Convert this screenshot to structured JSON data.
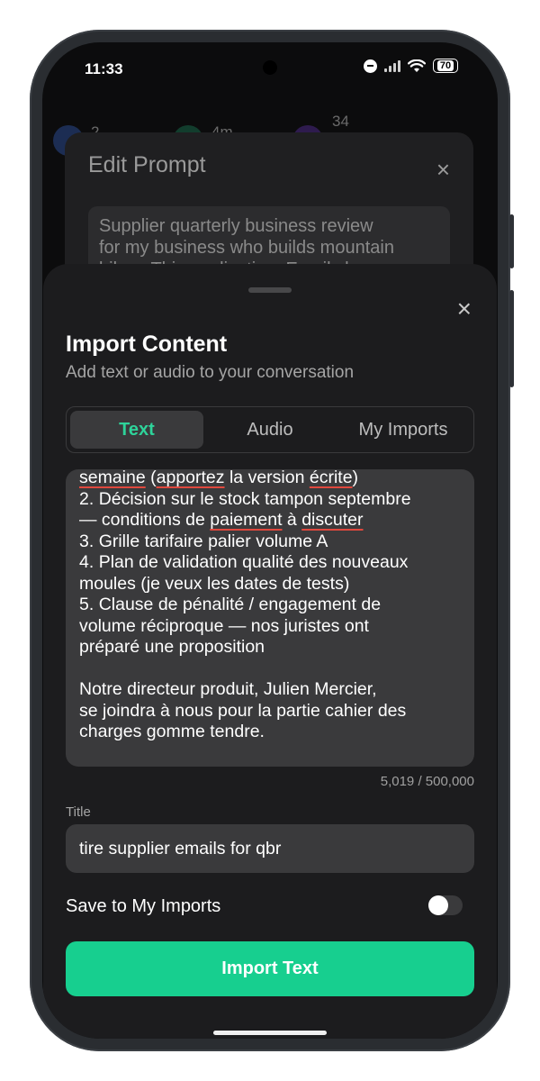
{
  "status_bar": {
    "time": "11:33",
    "battery": "70"
  },
  "background": {
    "chips": [
      "2",
      "4m",
      "34"
    ],
    "edit_prompt": {
      "title": "Edit Prompt",
      "close": "×",
      "text_lines": [
        "Supplier quarterly business review",
        "for my business who builds mountain",
        "bikes. This application: Email cha..."
      ]
    }
  },
  "sheet": {
    "close": "×",
    "title": "Import Content",
    "subtitle": "Add text or audio to your conversation",
    "tabs": [
      {
        "label": "Text",
        "active": true
      },
      {
        "label": "Audio",
        "active": false
      },
      {
        "label": "My Imports",
        "active": false
      }
    ],
    "content": {
      "lines": [
        "semaine (apportez la version écrite)",
        "2. Décision sur le stock tampon septembre",
        "— conditions de paiement à discuter",
        "3. Grille tarifaire palier volume A",
        "4. Plan de validation qualité des nouveaux",
        "moules (je veux les dates de tests)",
        "5. Clause de pénalité / engagement de",
        "volume réciproque — nos juristes ont",
        "préparé une proposition",
        "",
        "Notre directeur produit, Julien Mercier,",
        "se joindra à nous pour la partie cahier des",
        "charges gomme tendre."
      ],
      "spell_flags": [
        "semaine",
        "apportez",
        "écrite",
        "paiement",
        "discuter"
      ]
    },
    "char_count": "5,019 / 500,000",
    "title_label": "Title",
    "title_value": "tire supplier emails for qbr",
    "save_label": "Save to My Imports",
    "save_toggle": false,
    "import_button": "Import Text"
  },
  "colors": {
    "accent": "#17cf8f",
    "active_tab_text": "#2ed39a",
    "sheet_bg": "#1c1c1e",
    "field_bg": "#3a3a3c",
    "spell_underline": "#e0483e"
  }
}
